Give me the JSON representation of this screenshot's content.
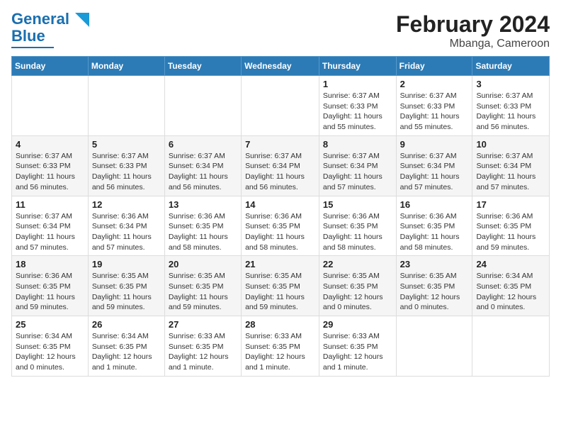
{
  "header": {
    "logo_general": "General",
    "logo_blue": "Blue",
    "title": "February 2024",
    "subtitle": "Mbanga, Cameroon"
  },
  "weekdays": [
    "Sunday",
    "Monday",
    "Tuesday",
    "Wednesday",
    "Thursday",
    "Friday",
    "Saturday"
  ],
  "weeks": [
    [
      {
        "day": "",
        "info": ""
      },
      {
        "day": "",
        "info": ""
      },
      {
        "day": "",
        "info": ""
      },
      {
        "day": "",
        "info": ""
      },
      {
        "day": "1",
        "info": "Sunrise: 6:37 AM\nSunset: 6:33 PM\nDaylight: 11 hours and 55 minutes."
      },
      {
        "day": "2",
        "info": "Sunrise: 6:37 AM\nSunset: 6:33 PM\nDaylight: 11 hours and 55 minutes."
      },
      {
        "day": "3",
        "info": "Sunrise: 6:37 AM\nSunset: 6:33 PM\nDaylight: 11 hours and 56 minutes."
      }
    ],
    [
      {
        "day": "4",
        "info": "Sunrise: 6:37 AM\nSunset: 6:33 PM\nDaylight: 11 hours and 56 minutes."
      },
      {
        "day": "5",
        "info": "Sunrise: 6:37 AM\nSunset: 6:33 PM\nDaylight: 11 hours and 56 minutes."
      },
      {
        "day": "6",
        "info": "Sunrise: 6:37 AM\nSunset: 6:34 PM\nDaylight: 11 hours and 56 minutes."
      },
      {
        "day": "7",
        "info": "Sunrise: 6:37 AM\nSunset: 6:34 PM\nDaylight: 11 hours and 56 minutes."
      },
      {
        "day": "8",
        "info": "Sunrise: 6:37 AM\nSunset: 6:34 PM\nDaylight: 11 hours and 57 minutes."
      },
      {
        "day": "9",
        "info": "Sunrise: 6:37 AM\nSunset: 6:34 PM\nDaylight: 11 hours and 57 minutes."
      },
      {
        "day": "10",
        "info": "Sunrise: 6:37 AM\nSunset: 6:34 PM\nDaylight: 11 hours and 57 minutes."
      }
    ],
    [
      {
        "day": "11",
        "info": "Sunrise: 6:37 AM\nSunset: 6:34 PM\nDaylight: 11 hours and 57 minutes."
      },
      {
        "day": "12",
        "info": "Sunrise: 6:36 AM\nSunset: 6:34 PM\nDaylight: 11 hours and 57 minutes."
      },
      {
        "day": "13",
        "info": "Sunrise: 6:36 AM\nSunset: 6:35 PM\nDaylight: 11 hours and 58 minutes."
      },
      {
        "day": "14",
        "info": "Sunrise: 6:36 AM\nSunset: 6:35 PM\nDaylight: 11 hours and 58 minutes."
      },
      {
        "day": "15",
        "info": "Sunrise: 6:36 AM\nSunset: 6:35 PM\nDaylight: 11 hours and 58 minutes."
      },
      {
        "day": "16",
        "info": "Sunrise: 6:36 AM\nSunset: 6:35 PM\nDaylight: 11 hours and 58 minutes."
      },
      {
        "day": "17",
        "info": "Sunrise: 6:36 AM\nSunset: 6:35 PM\nDaylight: 11 hours and 59 minutes."
      }
    ],
    [
      {
        "day": "18",
        "info": "Sunrise: 6:36 AM\nSunset: 6:35 PM\nDaylight: 11 hours and 59 minutes."
      },
      {
        "day": "19",
        "info": "Sunrise: 6:35 AM\nSunset: 6:35 PM\nDaylight: 11 hours and 59 minutes."
      },
      {
        "day": "20",
        "info": "Sunrise: 6:35 AM\nSunset: 6:35 PM\nDaylight: 11 hours and 59 minutes."
      },
      {
        "day": "21",
        "info": "Sunrise: 6:35 AM\nSunset: 6:35 PM\nDaylight: 11 hours and 59 minutes."
      },
      {
        "day": "22",
        "info": "Sunrise: 6:35 AM\nSunset: 6:35 PM\nDaylight: 12 hours and 0 minutes."
      },
      {
        "day": "23",
        "info": "Sunrise: 6:35 AM\nSunset: 6:35 PM\nDaylight: 12 hours and 0 minutes."
      },
      {
        "day": "24",
        "info": "Sunrise: 6:34 AM\nSunset: 6:35 PM\nDaylight: 12 hours and 0 minutes."
      }
    ],
    [
      {
        "day": "25",
        "info": "Sunrise: 6:34 AM\nSunset: 6:35 PM\nDaylight: 12 hours and 0 minutes."
      },
      {
        "day": "26",
        "info": "Sunrise: 6:34 AM\nSunset: 6:35 PM\nDaylight: 12 hours and 1 minute."
      },
      {
        "day": "27",
        "info": "Sunrise: 6:33 AM\nSunset: 6:35 PM\nDaylight: 12 hours and 1 minute."
      },
      {
        "day": "28",
        "info": "Sunrise: 6:33 AM\nSunset: 6:35 PM\nDaylight: 12 hours and 1 minute."
      },
      {
        "day": "29",
        "info": "Sunrise: 6:33 AM\nSunset: 6:35 PM\nDaylight: 12 hours and 1 minute."
      },
      {
        "day": "",
        "info": ""
      },
      {
        "day": "",
        "info": ""
      }
    ]
  ]
}
